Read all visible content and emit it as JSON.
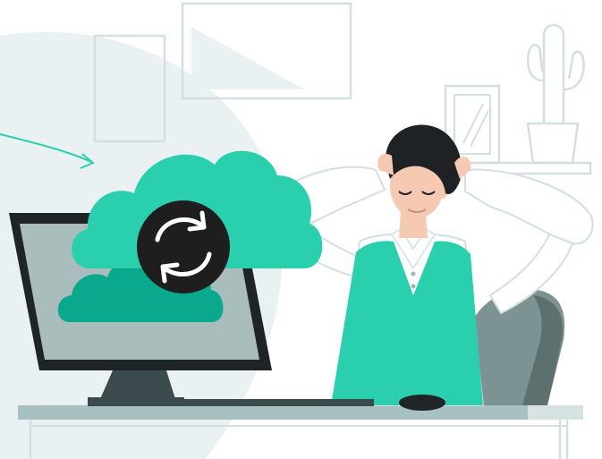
{
  "scene": {
    "description_name": "relaxed-man-cloud-sync-illustration"
  },
  "colors": {
    "background": "#ffffff",
    "backdrop_blob": "#eaf1f2",
    "line_art": "#d3dfe0",
    "cloud_light": "#2ad0ad",
    "cloud_dark": "#0aa88c",
    "sync_badge": "#1e1e1e",
    "sync_arrows": "#ffffff",
    "monitor_frame": "#1f2427",
    "monitor_screen": "#a9bdbd",
    "monitor_stand": "#3b4a4c",
    "desk_top": "#a9c0c0",
    "vest": "#2ad0ad",
    "shirt": "#ffffff",
    "skin": "#f6c9b3",
    "hair": "#1f2225",
    "chair": "#7d9292",
    "chair_dark": "#5c7070"
  },
  "icons": {
    "sync": "sync-arrows-icon",
    "upload_arrow": "curved-arrow-icon"
  }
}
